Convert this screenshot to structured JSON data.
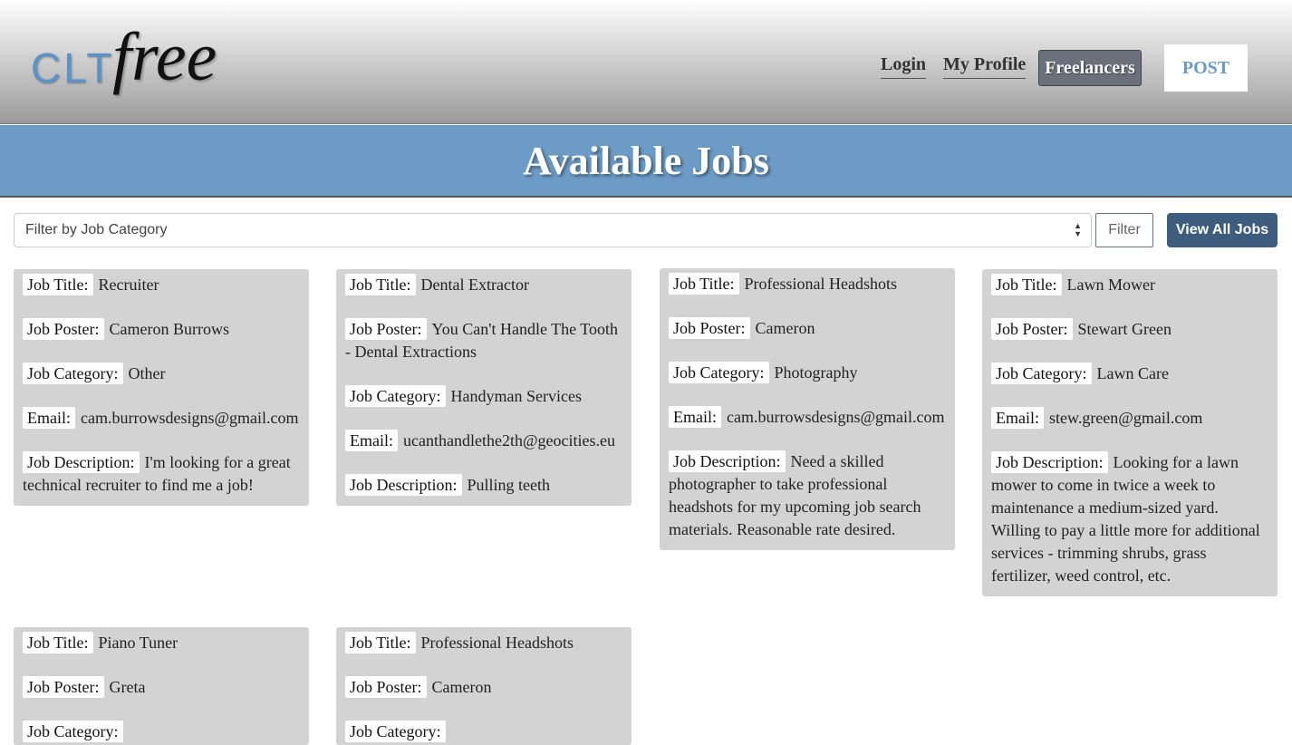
{
  "header": {
    "logo_prefix": "CLT",
    "logo_suffix": "free",
    "nav": {
      "login": "Login",
      "profile": "My Profile",
      "freelancers": "Freelancers",
      "post": "POST"
    }
  },
  "page_title": "Available Jobs",
  "filter": {
    "placeholder": "Filter by Job Category",
    "filter_button": "Filter",
    "view_all_button": "View All Jobs"
  },
  "labels": {
    "title": "Job Title:",
    "poster": "Job Poster:",
    "category": "Job Category:",
    "email": "Email:",
    "description": "Job Description:"
  },
  "jobs": [
    {
      "title": "Recruiter",
      "poster": "Cameron Burrows",
      "category": "Other",
      "email": "cam.burrowsdesigns@gmail.com",
      "description": "I'm looking for a great technical recruiter to find me a job!"
    },
    {
      "title": "Dental Extractor",
      "poster": "You Can't Handle The Tooth - Dental Extractions",
      "category": "Handyman Services",
      "email": "ucanthandlethe2th@geocities.eu",
      "description": "Pulling teeth"
    },
    {
      "title": "Professional Headshots",
      "poster": "Cameron",
      "category": "Photography",
      "email": "cam.burrowsdesigns@gmail.com",
      "description": "Need a skilled photographer to take professional headshots for my upcoming job search materials. Reasonable rate desired."
    },
    {
      "title": "Lawn Mower",
      "poster": "Stewart Green",
      "category": "Lawn Care",
      "email": "stew.green@gmail.com",
      "description": "Looking for a lawn mower to come in twice a week to maintenance a medium-sized yard. Willing to pay a little more for additional services - trimming shrubs, grass fertilizer, weed control, etc."
    },
    {
      "title": "Piano Tuner",
      "poster": "Greta",
      "category": "",
      "email": "",
      "description": ""
    },
    {
      "title": "Professional Headshots",
      "poster": "Cameron",
      "category": "",
      "email": "",
      "description": ""
    }
  ]
}
